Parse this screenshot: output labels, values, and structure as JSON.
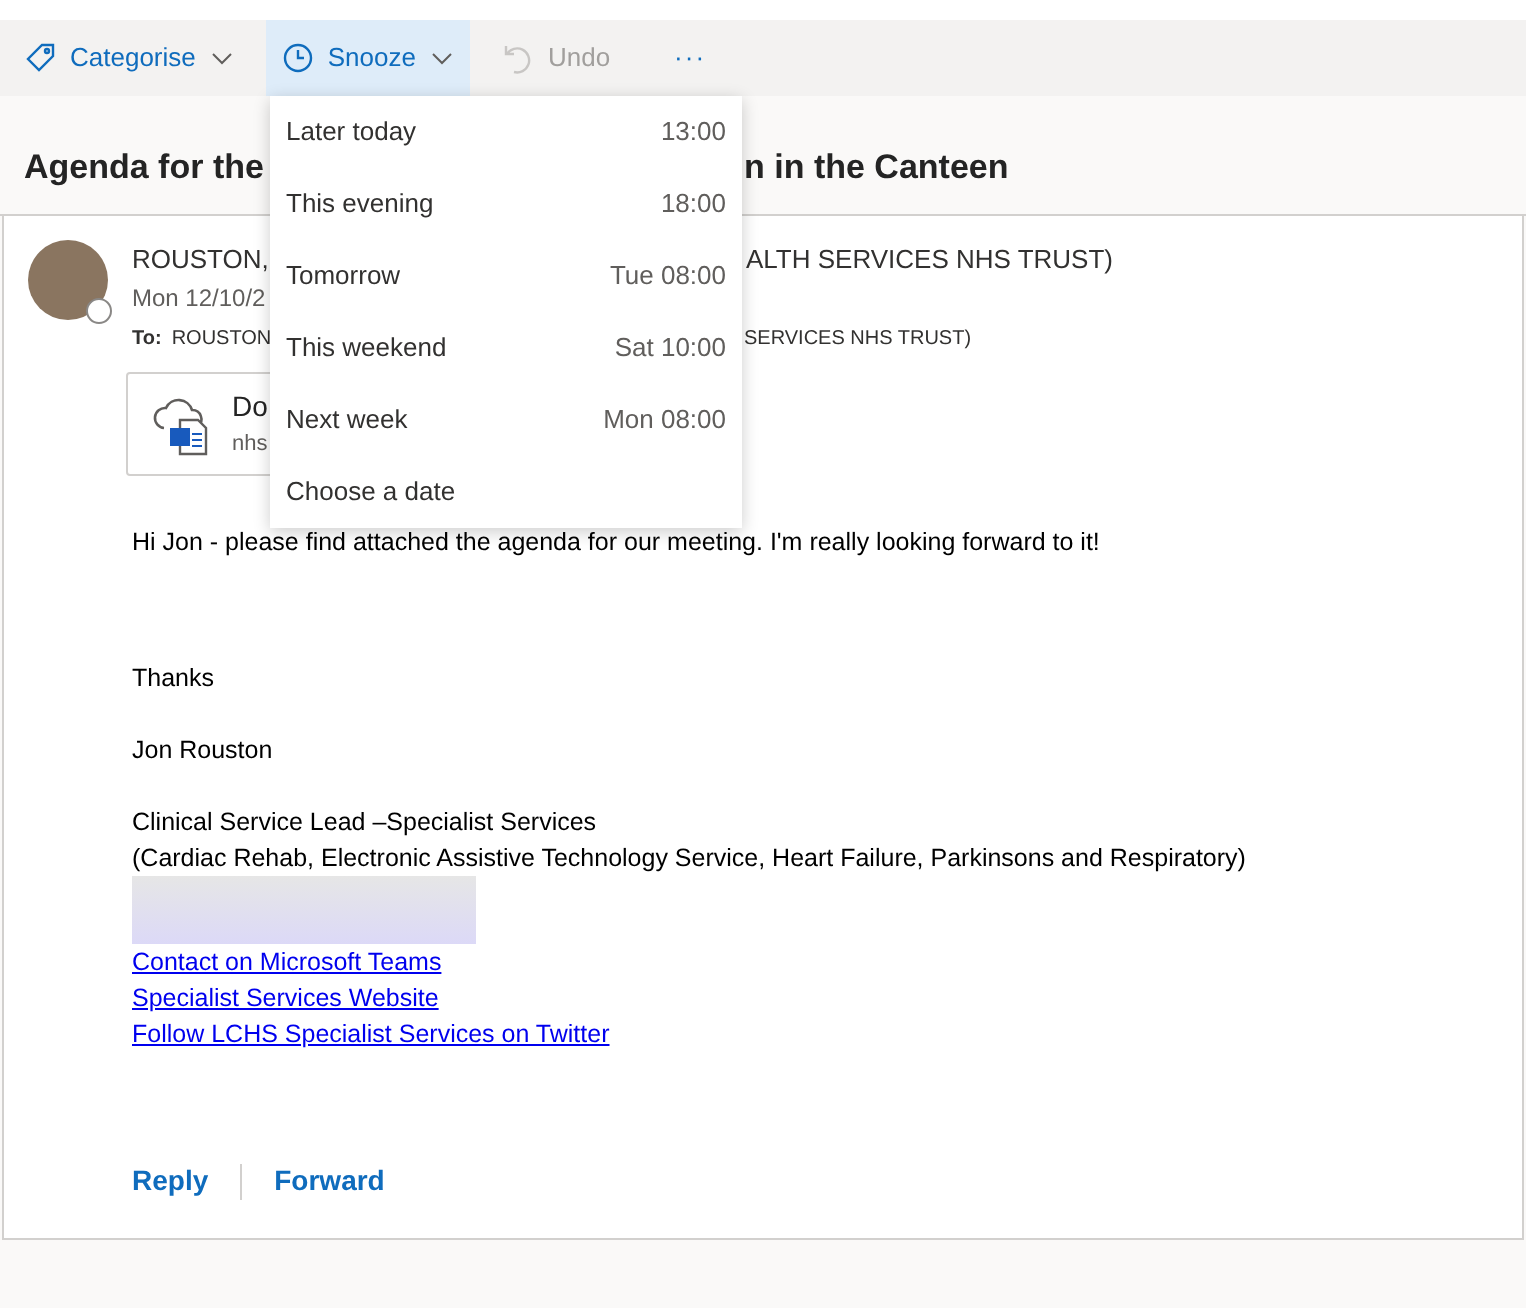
{
  "toolbar": [
    {
      "kind": "category",
      "label": "Categorise",
      "selected": false,
      "disabled": false
    },
    {
      "kind": "snooze",
      "label": "Snooze",
      "selected": true,
      "disabled": false
    },
    {
      "kind": "undo",
      "label": "Undo",
      "selected": false,
      "disabled": true
    },
    {
      "kind": "more",
      "label": "···",
      "selected": false,
      "disabled": false
    }
  ],
  "snooze_menu": [
    {
      "label": "Later today",
      "time": "13:00"
    },
    {
      "label": "This evening",
      "time": "18:00"
    },
    {
      "label": "Tomorrow",
      "time": "Tue 08:00"
    },
    {
      "label": "This weekend",
      "time": "Sat 10:00"
    },
    {
      "label": "Next week",
      "time": "Mon 08:00"
    },
    {
      "label": "Choose a date"
    }
  ],
  "subject": {
    "left": "Agenda for the",
    "right": "n in the Canteen"
  },
  "message": {
    "sender_left": "ROUSTON,",
    "sender_right": "ALTH SERVICES NHS TRUST)",
    "date": "Mon 12/10/2",
    "to_label": "To:",
    "to_left": "ROUSTON",
    "to_right": "SERVICES NHS TRUST)",
    "attachment": {
      "name": "Do",
      "source": "nhs"
    },
    "body": [
      {
        "kind": "text",
        "text": "Hi Jon - please find attached the agenda for our meeting. I'm really looking forward to it!"
      },
      {
        "kind": "gap"
      },
      {
        "kind": "text",
        "text": "Thanks"
      },
      {
        "kind": "blank"
      },
      {
        "kind": "text",
        "text": "Jon Rouston"
      },
      {
        "kind": "blank"
      },
      {
        "kind": "text",
        "text": "Clinical Service Lead –Specialist Services"
      },
      {
        "kind": "text",
        "text": "(Cardiac Rehab, Electronic Assistive Technology Service, Heart Failure, Parkinsons and Respiratory)"
      },
      {
        "kind": "redacted"
      },
      {
        "kind": "link",
        "text": "Contact on Microsoft Teams"
      },
      {
        "kind": "link",
        "text": "Specialist Services Website"
      },
      {
        "kind": "link",
        "text": "Follow LCHS Specialist Services on Twitter"
      }
    ],
    "actions": [
      "Reply",
      "Forward"
    ]
  }
}
